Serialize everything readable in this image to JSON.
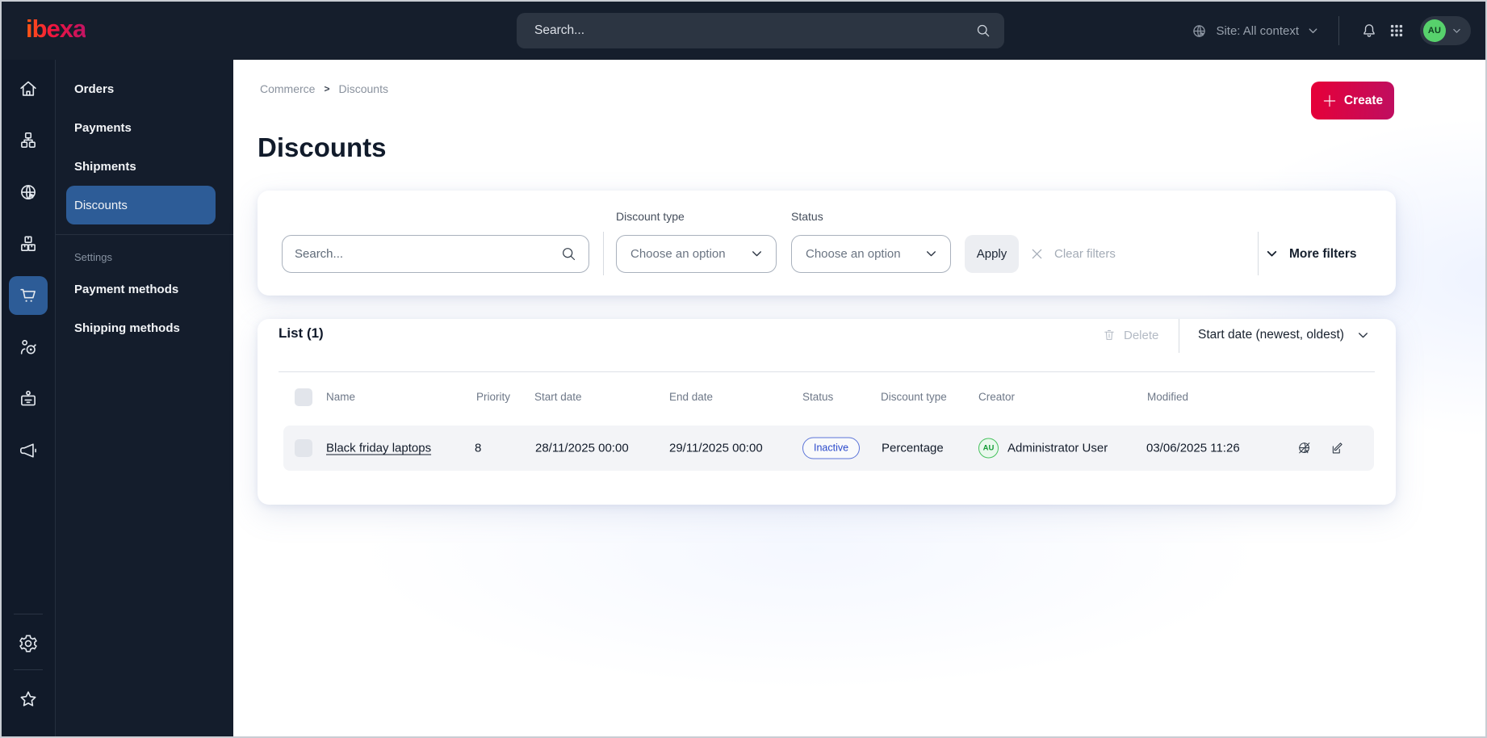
{
  "topbar": {
    "logo": "ibexa",
    "search_placeholder": "Search...",
    "site_context": "Site: All context",
    "avatar_initials": "AU"
  },
  "menu": {
    "items": [
      "Orders",
      "Payments",
      "Shipments",
      "Discounts"
    ],
    "active_item": "Discounts",
    "section_label": "Settings",
    "settings_items": [
      "Payment methods",
      "Shipping methods"
    ]
  },
  "breadcrumb": {
    "parent": "Commerce",
    "current": "Discounts"
  },
  "page": {
    "title": "Discounts",
    "create_label": "Create"
  },
  "filters": {
    "search_placeholder": "Search...",
    "discount_type_label": "Discount type",
    "discount_type_value": "Choose an option",
    "status_label": "Status",
    "status_value": "Choose an option",
    "apply_label": "Apply",
    "clear_label": "Clear filters",
    "more_label": "More filters"
  },
  "list": {
    "title": "List (1)",
    "delete_label": "Delete",
    "sort_label": "Start date (newest, oldest)",
    "columns": [
      "Name",
      "Priority",
      "Start date",
      "End date",
      "Status",
      "Discount type",
      "Creator",
      "Modified"
    ],
    "rows": [
      {
        "name": "Black friday laptops",
        "priority": "8",
        "start_date": "28/11/2025 00:00",
        "end_date": "29/11/2025 00:00",
        "status": "Inactive",
        "discount_type": "Percentage",
        "creator_initials": "AU",
        "creator": "Administrator User",
        "modified": "03/06/2025 11:26"
      }
    ]
  },
  "colors": {
    "topbar_bg": "#151e2c",
    "sidebar_bg": "#141d2c",
    "active_blue": "#2d5c97",
    "brand_gradient_start": "#e60038",
    "brand_gradient_end": "#bf0e60",
    "badge_blue": "#2a49cb",
    "avatar_green": "#46c25e",
    "row_bg": "#f3f4f7"
  }
}
